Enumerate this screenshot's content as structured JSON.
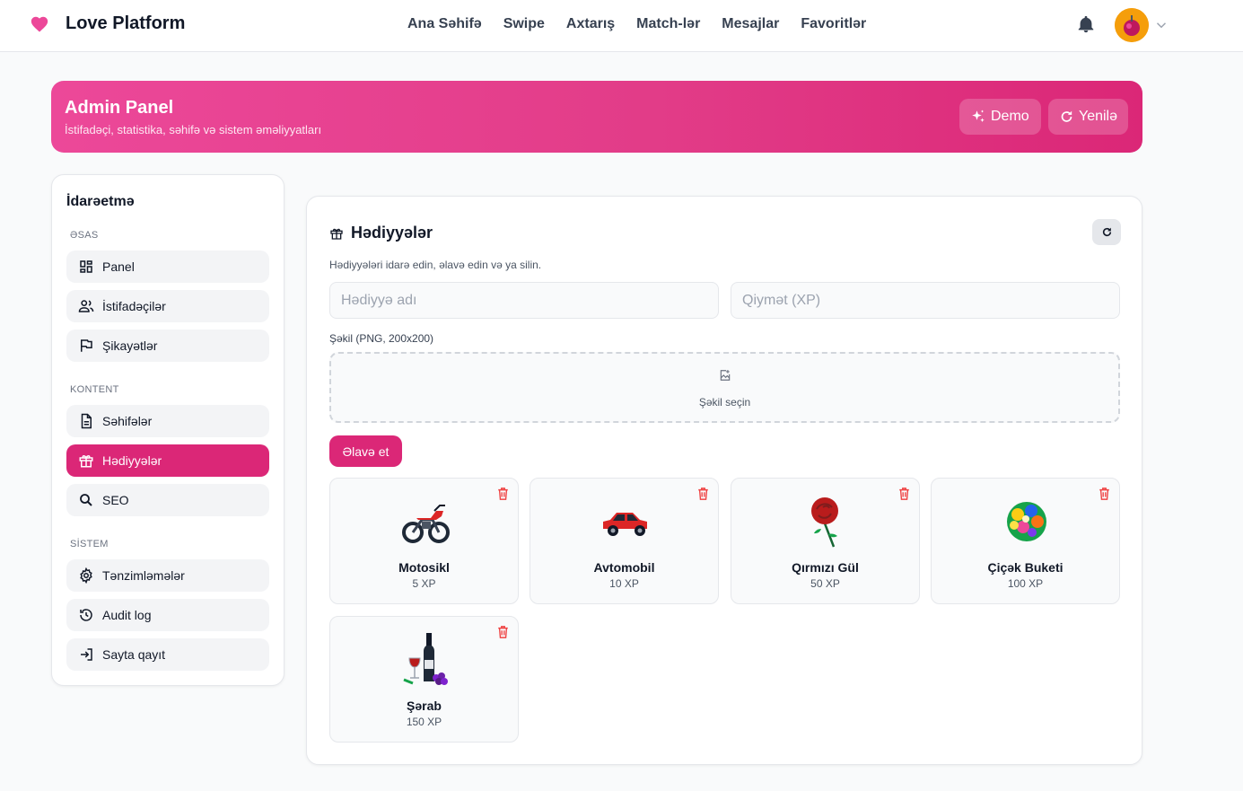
{
  "app": {
    "brand": "Love Platform",
    "nav": [
      "Ana Səhifə",
      "Swipe",
      "Axtarış",
      "Match-lər",
      "Mesajlar",
      "Favoritlər"
    ]
  },
  "banner": {
    "title": "Admin Panel",
    "subtitle": "İstifadəçi, statistika, səhifə və sistem əməliyyatları",
    "demo_label": "Demo",
    "refresh_label": "Yenilə"
  },
  "sidebar": {
    "title": "İdarəetmə",
    "sections": [
      {
        "label": "ƏSAS",
        "items": [
          {
            "label": "Panel",
            "icon": "dashboard-icon"
          },
          {
            "label": "İstifadəçilər",
            "icon": "users-icon"
          },
          {
            "label": "Şikayətlər",
            "icon": "flag-icon"
          }
        ]
      },
      {
        "label": "KONTENT",
        "items": [
          {
            "label": "Səhifələr",
            "icon": "document-icon"
          },
          {
            "label": "Hədiyyələr",
            "icon": "gift-icon",
            "active": true
          },
          {
            "label": "SEO",
            "icon": "search-icon"
          }
        ]
      },
      {
        "label": "SİSTEM",
        "items": [
          {
            "label": "Tənzimləmələr",
            "icon": "gear-icon"
          },
          {
            "label": "Audit log",
            "icon": "history-icon"
          },
          {
            "label": "Sayta qayıt",
            "icon": "exit-icon"
          }
        ]
      }
    ]
  },
  "gifts_panel": {
    "title": "Hədiyyələr",
    "description": "Hədiyyələri idarə edin, əlavə edin və ya silin.",
    "name_placeholder": "Hədiyyə adı",
    "price_placeholder": "Qiymət (XP)",
    "image_label": "Şəkil (PNG, 200x200)",
    "dropzone_label": "Şəkil seçin",
    "add_label": "Əlavə et",
    "items": [
      {
        "name": "Motosikl",
        "price": "5 XP",
        "icon": "motorcycle-icon"
      },
      {
        "name": "Avtomobil",
        "price": "10 XP",
        "icon": "car-icon"
      },
      {
        "name": "Qırmızı Gül",
        "price": "50 XP",
        "icon": "rose-icon"
      },
      {
        "name": "Çiçək Buketi",
        "price": "100 XP",
        "icon": "bouquet-icon"
      },
      {
        "name": "Şərab",
        "price": "150 XP",
        "icon": "wine-icon"
      }
    ]
  },
  "colors": {
    "accent": "#db2777",
    "banner_start": "#ec4899",
    "delete": "#ef4444"
  }
}
